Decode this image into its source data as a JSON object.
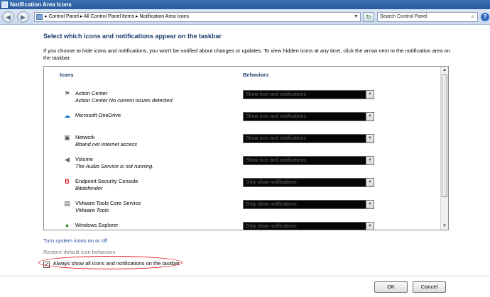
{
  "window": {
    "title": "Notification Area Icons"
  },
  "nav": {
    "back_glyph": "◀",
    "forward_glyph": "▶",
    "breadcrumb": "▸ Control Panel ▸ All Control Panel Items ▸ Notification Area Icons",
    "search_placeholder": "Search Control Panel"
  },
  "main": {
    "heading": "Select which icons and notifications appear on the taskbar",
    "description": "If you choose to hide icons and notifications, you won't be notified about changes or updates. To view hidden icons at any time, click the arrow next to the notification area on the taskbar."
  },
  "list": {
    "col_icons": "Icons",
    "col_behaviors": "Behaviors",
    "rows": [
      {
        "icon": "flag-icon",
        "name": "Action Center",
        "status": "Action Center  No current issues detected",
        "behavior": "Show icon and notifications"
      },
      {
        "icon": "cloud-icon",
        "name": "Microsoft OneDrive",
        "status": "",
        "behavior": "Show icon and notifications"
      },
      {
        "icon": "network-icon",
        "name": "Network",
        "status": "Bband.net Internet access",
        "behavior": "Show icon and notifications"
      },
      {
        "icon": "speaker-icon",
        "name": "Volume",
        "status": "The Audio Service is not running.",
        "behavior": "Show icon and notifications"
      },
      {
        "icon": "bitdefender-icon",
        "name": "Endpoint Security Console",
        "status": "Bitdefender",
        "behavior": "Only show notifications"
      },
      {
        "icon": "vmware-icon",
        "name": "VMware Tools Core Service",
        "status": "VMware Tools",
        "behavior": "Only show notifications"
      },
      {
        "icon": "safely-remove-icon",
        "name": "Windows Explorer",
        "status": "",
        "behavior": "Only show notifications"
      }
    ]
  },
  "links": {
    "system_icons": "Turn system icons on or off",
    "restore_defaults": "Restore default icon behaviors"
  },
  "checkbox": {
    "label": "Always show all icons and notifications on the taskbar",
    "mark": "✓"
  },
  "buttons": {
    "ok": "OK",
    "cancel": "Cancel"
  },
  "colors": {
    "annotation": "#e3141b",
    "link": "#1a4a9a",
    "heading": "#1b3a6b"
  }
}
